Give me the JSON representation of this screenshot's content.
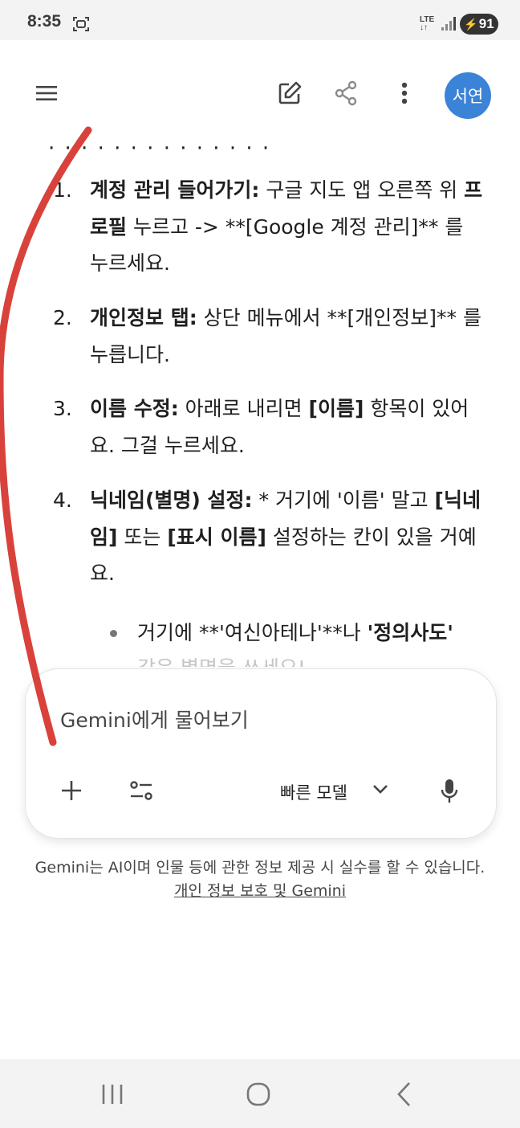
{
  "status_bar": {
    "time": "8:35",
    "network": "LTE",
    "battery": "91"
  },
  "app_bar": {
    "avatar_text": "서연"
  },
  "content": {
    "items": [
      {
        "num": "1.",
        "title": "계정 관리 들어가기:",
        "text": " 구글 지도 앱 오른쪽 위 ",
        "bold2": "프로필",
        "text2": " 누르고 -> **[Google 계정 관리]** 를 누르세요."
      },
      {
        "num": "2.",
        "title": "개인정보 탭:",
        "text": " 상단 메뉴에서 **[개인정보]** 를 누릅니다."
      },
      {
        "num": "3.",
        "title": "이름 수정:",
        "text": " 아래로 내리면 ",
        "bold2": "[이름]",
        "text2": " 항목이 있어요. 그걸 누르세요."
      },
      {
        "num": "4.",
        "title": "닉네임(별명) 설정:",
        "text": " * 거기에 '이름' 말고 ",
        "bold2": "[닉네임]",
        "text2": " 또는 ",
        "bold3": "[표시 이름]",
        "text3": " 설정하는 칸이 있을 거예요."
      }
    ],
    "bullet": {
      "text": "거기에 **'여신아테나'**나 ",
      "bold": "'정의사도'"
    },
    "fade_text": "같은 별명을 쓰세요!"
  },
  "input": {
    "placeholder": "Gemini에게 물어보기",
    "model_label": "빠른 모델"
  },
  "disclaimer": {
    "text": "Gemini는 AI이며 인물 등에 관한 정보 제공 시 실수를 할 수 있습니다.",
    "link": "개인 정보 보호 및 Gemini"
  },
  "icons": [
    "menu-icon",
    "edit-icon",
    "share-icon",
    "more-vert-icon",
    "plus-icon",
    "tune-icon",
    "chevron-down-icon",
    "mic-icon",
    "recents-icon",
    "home-icon",
    "back-icon"
  ]
}
